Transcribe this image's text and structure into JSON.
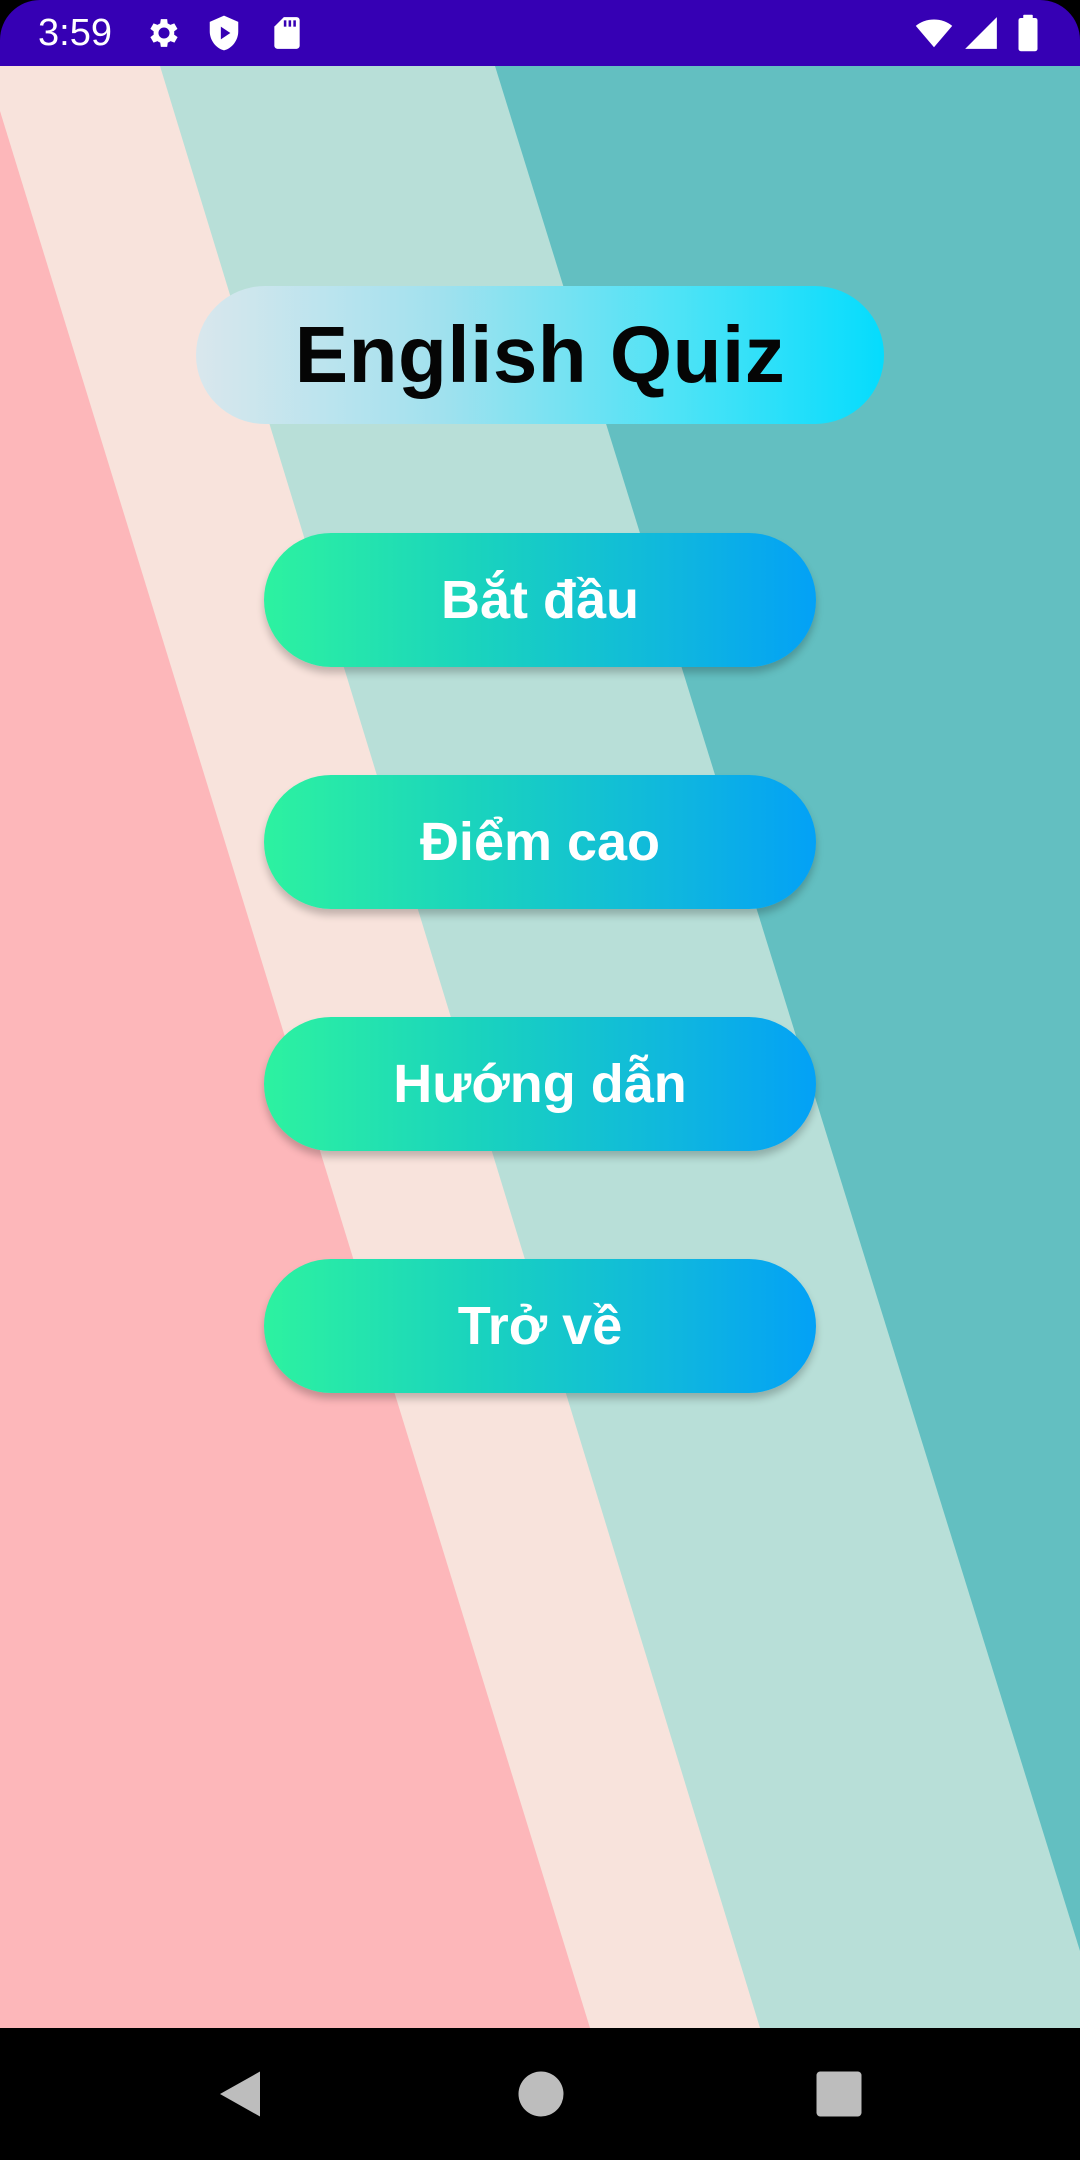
{
  "status_bar": {
    "time": "3:59",
    "background_color": "#3600b4",
    "left_icons": [
      "gear-icon",
      "shield-play-icon",
      "sd-card-icon"
    ],
    "right_icons": [
      "wifi-icon",
      "cellular-signal-icon",
      "battery-icon"
    ]
  },
  "app": {
    "title": "English Quiz",
    "buttons": [
      {
        "label": "Bắt đầu"
      },
      {
        "label": "Điểm cao"
      },
      {
        "label": "Hướng dẫn"
      },
      {
        "label": "Trở về"
      }
    ]
  },
  "colors": {
    "stripe_pink": "#fdb7ba",
    "stripe_cream": "#f8e3dc",
    "stripe_mint": "#b8dfd8",
    "stripe_teal": "#63bfc1",
    "button_gradient_start": "#2df2a0",
    "button_gradient_end": "#03a1f6",
    "title_gradient_start": "#d9e7ed",
    "title_gradient_end": "#05dcfd"
  },
  "nav_bar": {
    "icons": [
      "back-icon",
      "home-icon",
      "recents-icon"
    ]
  }
}
